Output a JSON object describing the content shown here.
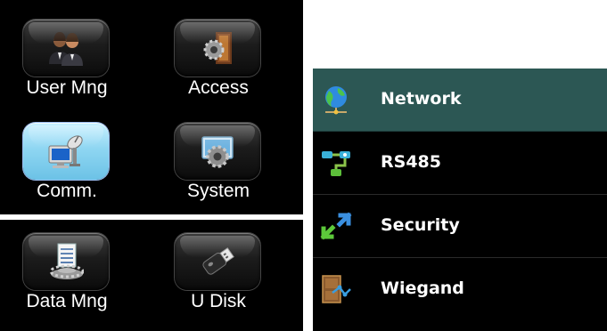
{
  "main_menu": {
    "tiles": [
      {
        "label": "User Mng",
        "icon": "users-icon"
      },
      {
        "label": "Access",
        "icon": "door-gear-icon"
      },
      {
        "label": "Comm.",
        "icon": "computer-satellite-icon",
        "selected": true
      },
      {
        "label": "System",
        "icon": "system-gear-icon"
      },
      {
        "label": "Data Mng",
        "icon": "database-gear-icon"
      },
      {
        "label": "U Disk",
        "icon": "usb-drive-icon"
      }
    ]
  },
  "comm_menu": {
    "items": [
      {
        "label": "Network",
        "icon": "globe-network-icon",
        "selected": true
      },
      {
        "label": "RS485",
        "icon": "rs485-connection-icon"
      },
      {
        "label": "Security",
        "icon": "security-arrows-icon"
      },
      {
        "label": "Wiegand",
        "icon": "wiegand-door-icon"
      }
    ]
  },
  "colors": {
    "background": "#000000",
    "selected_row": "#2c5754",
    "selected_tile": "#8fd6f2",
    "text": "#ffffff"
  }
}
